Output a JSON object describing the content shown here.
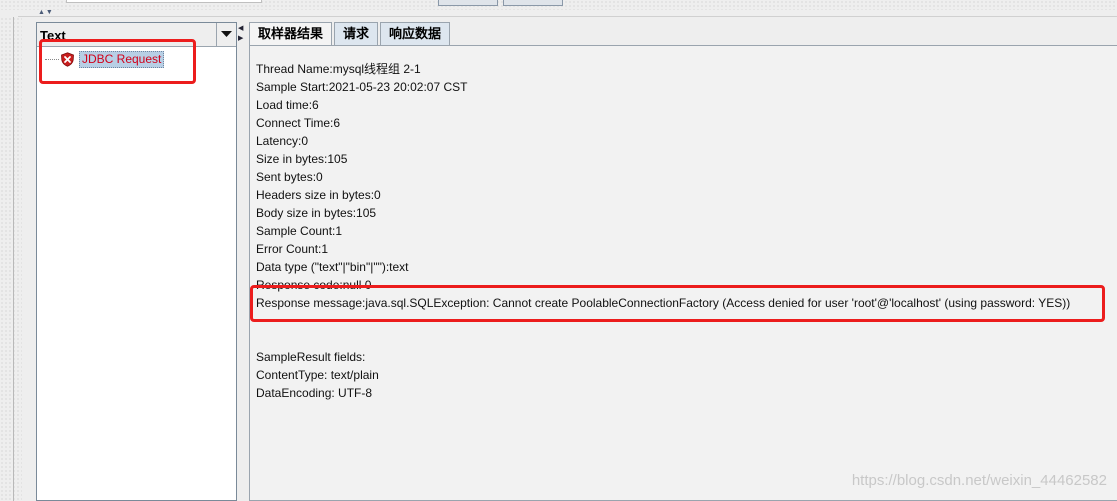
{
  "tree": {
    "combo_label": "Text",
    "items": [
      {
        "label": "JDBC Request",
        "status": "error"
      }
    ]
  },
  "tabs": [
    {
      "label": "取样器结果",
      "active": true
    },
    {
      "label": "请求",
      "active": false
    },
    {
      "label": "响应数据",
      "active": false
    }
  ],
  "result": {
    "thread_name": "Thread Name:mysql线程组 2-1",
    "sample_start": "Sample Start:2021-05-23 20:02:07 CST",
    "load_time": "Load time:6",
    "connect_time": "Connect Time:6",
    "latency": "Latency:0",
    "size_in_bytes": "Size in bytes:105",
    "sent_bytes": "Sent bytes:0",
    "headers_size": "Headers size in bytes:0",
    "body_size": "Body size in bytes:105",
    "sample_count": "Sample Count:1",
    "error_count": "Error Count:1",
    "data_type": "Data type (\"text\"|\"bin\"|\"\"):text",
    "response_code": "Response code:null 0",
    "response_message": "Response message:java.sql.SQLException: Cannot create PoolableConnectionFactory (Access denied for user 'root'@'localhost' (using password: YES))",
    "fields_header": "SampleResult fields:",
    "content_type": "ContentType: text/plain",
    "data_encoding": "DataEncoding: UTF-8"
  },
  "watermark": "https://blog.csdn.net/weixin_44462582",
  "colors": {
    "highlight_red": "#ec1d1d",
    "error_text": "#d0021b",
    "selection_bg": "#b8cfe5"
  }
}
